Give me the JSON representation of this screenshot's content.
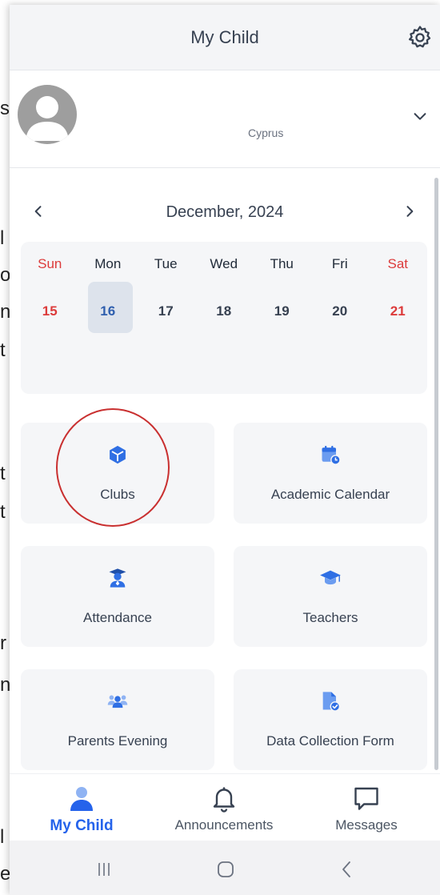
{
  "underlay_letters": [
    "s",
    "l",
    "o",
    "n",
    "t",
    "t",
    "t",
    "r",
    "n",
    "l",
    "e"
  ],
  "header": {
    "title": "My Child"
  },
  "profile": {
    "subtitle": "Cyprus"
  },
  "calendar": {
    "month": "December, 2024",
    "weekdays": [
      "Sun",
      "Mon",
      "Tue",
      "Wed",
      "Thu",
      "Fri",
      "Sat"
    ],
    "days": [
      "15",
      "16",
      "17",
      "18",
      "19",
      "20",
      "21"
    ],
    "selected": "16"
  },
  "tiles": [
    {
      "label": "Clubs",
      "icon": "cube-icon"
    },
    {
      "label": "Academic Calendar",
      "icon": "calendar-clock-icon"
    },
    {
      "label": "Attendance",
      "icon": "graduate-icon"
    },
    {
      "label": "Teachers",
      "icon": "graduation-cap-icon"
    },
    {
      "label": "Parents Evening",
      "icon": "people-group-icon"
    },
    {
      "label": "Data Collection Form",
      "icon": "file-check-icon"
    }
  ],
  "bottom_nav": [
    {
      "label": "My Child",
      "icon": "person-icon",
      "active": true
    },
    {
      "label": "Announcements",
      "icon": "bell-icon",
      "active": false
    },
    {
      "label": "Messages",
      "icon": "chat-bubble-icon",
      "active": false
    }
  ],
  "colors": {
    "accent": "#2563eb",
    "weekend": "#dc3b3b",
    "tile_bg": "#f5f6f8",
    "annotation": "#c93030"
  }
}
